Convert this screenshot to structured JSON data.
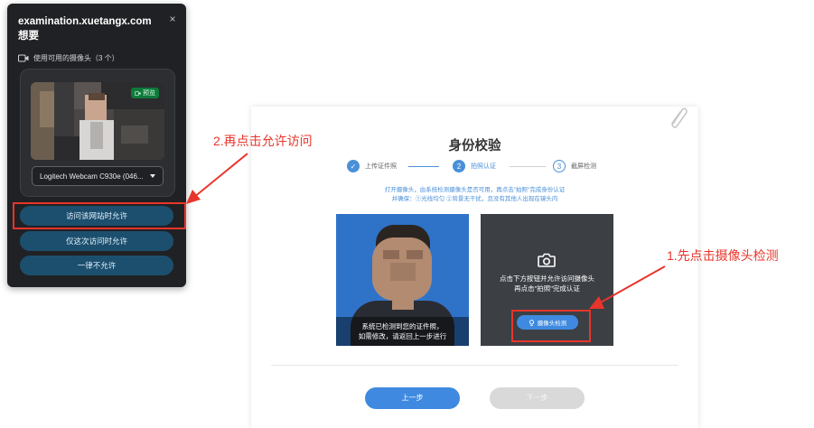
{
  "popup": {
    "title": "examination.xuetangx.com 想要",
    "close_symbol": "×",
    "permission_label": "使用可用的摄像头（3 个）",
    "preview_badge": "预览",
    "camera_select_value": "Logitech Webcam C930e (046...",
    "buttons": {
      "allow_always": "访问该网站时允许",
      "allow_once": "仅这次访问时允许",
      "deny": "一律不允许"
    }
  },
  "annotations": {
    "step2": "2.再点击允许访问",
    "step1": "1.先点击摄像头检测"
  },
  "page": {
    "title": "身份校验",
    "steps": [
      {
        "number": "1",
        "label": "上传证件照",
        "status": "done"
      },
      {
        "number": "2",
        "label": "拍照认证",
        "status": "active"
      },
      {
        "number": "3",
        "label": "截屏检测",
        "status": "pending"
      }
    ],
    "hint_line1": "打开摄像头，由系统检测摄像头是否可用，再点击\"拍照\"完成身份认证",
    "hint_line2": "并确保：①光线均匀 ②背景无干扰，且没有其他人出现在镜头内",
    "id_caption_line1": "系统已检测到您的证件照，",
    "id_caption_line2": "如需修改，请返回上一步进行",
    "camera_hint_line1": "点击下方按钮并允许访问摄像头",
    "camera_hint_line2": "再点击\"拍照\"完成认证",
    "detect_button": "摄像头检测",
    "prev_button": "上一步",
    "next_button": "下一步"
  },
  "colors": {
    "accent_blue": "#3f8ae0",
    "annotation_red": "#e8352b",
    "popup_bg": "#202124",
    "popup_button": "#1c4f6e",
    "disabled_button": "#d9d9d9"
  },
  "icons": [
    "camera-permission-icon",
    "close-icon",
    "chevron-down-icon",
    "paperclip-icon",
    "check-icon",
    "camera-icon"
  ]
}
